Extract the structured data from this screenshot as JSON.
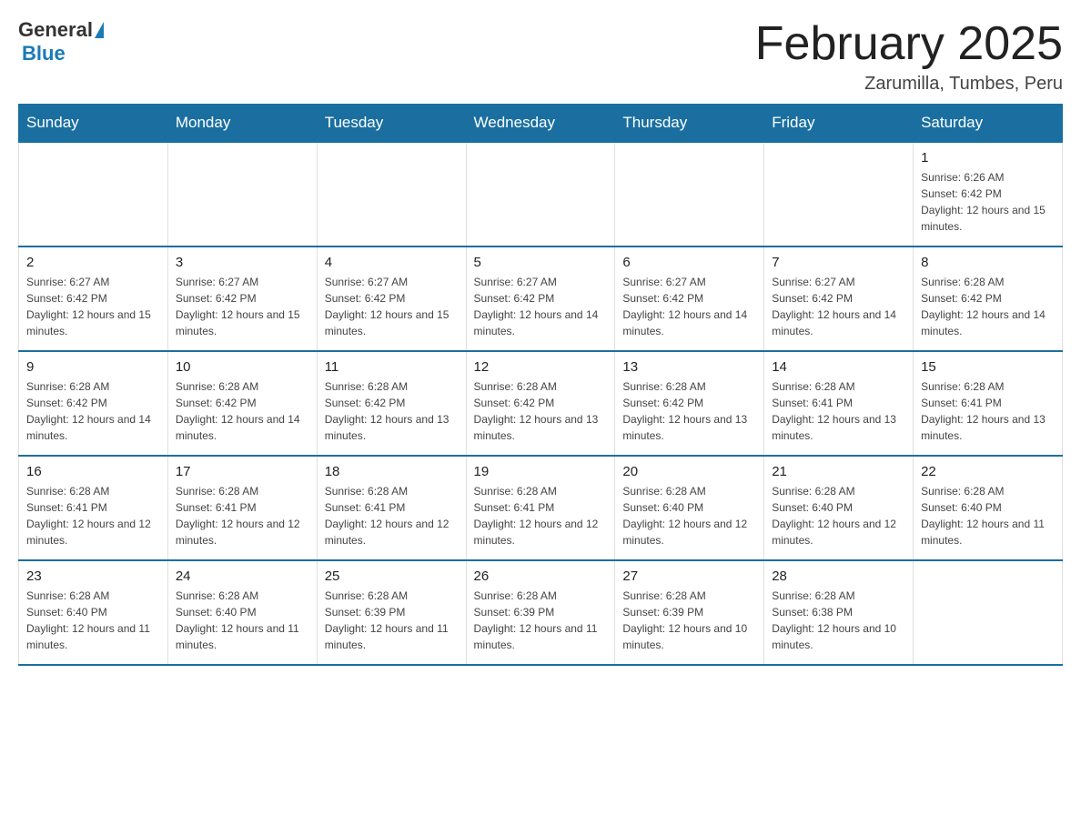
{
  "header": {
    "logo_general": "General",
    "logo_blue": "Blue",
    "month_title": "February 2025",
    "location": "Zarumilla, Tumbes, Peru"
  },
  "weekdays": [
    "Sunday",
    "Monday",
    "Tuesday",
    "Wednesday",
    "Thursday",
    "Friday",
    "Saturday"
  ],
  "weeks": [
    [
      {
        "day": "",
        "info": ""
      },
      {
        "day": "",
        "info": ""
      },
      {
        "day": "",
        "info": ""
      },
      {
        "day": "",
        "info": ""
      },
      {
        "day": "",
        "info": ""
      },
      {
        "day": "",
        "info": ""
      },
      {
        "day": "1",
        "info": "Sunrise: 6:26 AM\nSunset: 6:42 PM\nDaylight: 12 hours and 15 minutes."
      }
    ],
    [
      {
        "day": "2",
        "info": "Sunrise: 6:27 AM\nSunset: 6:42 PM\nDaylight: 12 hours and 15 minutes."
      },
      {
        "day": "3",
        "info": "Sunrise: 6:27 AM\nSunset: 6:42 PM\nDaylight: 12 hours and 15 minutes."
      },
      {
        "day": "4",
        "info": "Sunrise: 6:27 AM\nSunset: 6:42 PM\nDaylight: 12 hours and 15 minutes."
      },
      {
        "day": "5",
        "info": "Sunrise: 6:27 AM\nSunset: 6:42 PM\nDaylight: 12 hours and 14 minutes."
      },
      {
        "day": "6",
        "info": "Sunrise: 6:27 AM\nSunset: 6:42 PM\nDaylight: 12 hours and 14 minutes."
      },
      {
        "day": "7",
        "info": "Sunrise: 6:27 AM\nSunset: 6:42 PM\nDaylight: 12 hours and 14 minutes."
      },
      {
        "day": "8",
        "info": "Sunrise: 6:28 AM\nSunset: 6:42 PM\nDaylight: 12 hours and 14 minutes."
      }
    ],
    [
      {
        "day": "9",
        "info": "Sunrise: 6:28 AM\nSunset: 6:42 PM\nDaylight: 12 hours and 14 minutes."
      },
      {
        "day": "10",
        "info": "Sunrise: 6:28 AM\nSunset: 6:42 PM\nDaylight: 12 hours and 14 minutes."
      },
      {
        "day": "11",
        "info": "Sunrise: 6:28 AM\nSunset: 6:42 PM\nDaylight: 12 hours and 13 minutes."
      },
      {
        "day": "12",
        "info": "Sunrise: 6:28 AM\nSunset: 6:42 PM\nDaylight: 12 hours and 13 minutes."
      },
      {
        "day": "13",
        "info": "Sunrise: 6:28 AM\nSunset: 6:42 PM\nDaylight: 12 hours and 13 minutes."
      },
      {
        "day": "14",
        "info": "Sunrise: 6:28 AM\nSunset: 6:41 PM\nDaylight: 12 hours and 13 minutes."
      },
      {
        "day": "15",
        "info": "Sunrise: 6:28 AM\nSunset: 6:41 PM\nDaylight: 12 hours and 13 minutes."
      }
    ],
    [
      {
        "day": "16",
        "info": "Sunrise: 6:28 AM\nSunset: 6:41 PM\nDaylight: 12 hours and 12 minutes."
      },
      {
        "day": "17",
        "info": "Sunrise: 6:28 AM\nSunset: 6:41 PM\nDaylight: 12 hours and 12 minutes."
      },
      {
        "day": "18",
        "info": "Sunrise: 6:28 AM\nSunset: 6:41 PM\nDaylight: 12 hours and 12 minutes."
      },
      {
        "day": "19",
        "info": "Sunrise: 6:28 AM\nSunset: 6:41 PM\nDaylight: 12 hours and 12 minutes."
      },
      {
        "day": "20",
        "info": "Sunrise: 6:28 AM\nSunset: 6:40 PM\nDaylight: 12 hours and 12 minutes."
      },
      {
        "day": "21",
        "info": "Sunrise: 6:28 AM\nSunset: 6:40 PM\nDaylight: 12 hours and 12 minutes."
      },
      {
        "day": "22",
        "info": "Sunrise: 6:28 AM\nSunset: 6:40 PM\nDaylight: 12 hours and 11 minutes."
      }
    ],
    [
      {
        "day": "23",
        "info": "Sunrise: 6:28 AM\nSunset: 6:40 PM\nDaylight: 12 hours and 11 minutes."
      },
      {
        "day": "24",
        "info": "Sunrise: 6:28 AM\nSunset: 6:40 PM\nDaylight: 12 hours and 11 minutes."
      },
      {
        "day": "25",
        "info": "Sunrise: 6:28 AM\nSunset: 6:39 PM\nDaylight: 12 hours and 11 minutes."
      },
      {
        "day": "26",
        "info": "Sunrise: 6:28 AM\nSunset: 6:39 PM\nDaylight: 12 hours and 11 minutes."
      },
      {
        "day": "27",
        "info": "Sunrise: 6:28 AM\nSunset: 6:39 PM\nDaylight: 12 hours and 10 minutes."
      },
      {
        "day": "28",
        "info": "Sunrise: 6:28 AM\nSunset: 6:38 PM\nDaylight: 12 hours and 10 minutes."
      },
      {
        "day": "",
        "info": ""
      }
    ]
  ]
}
